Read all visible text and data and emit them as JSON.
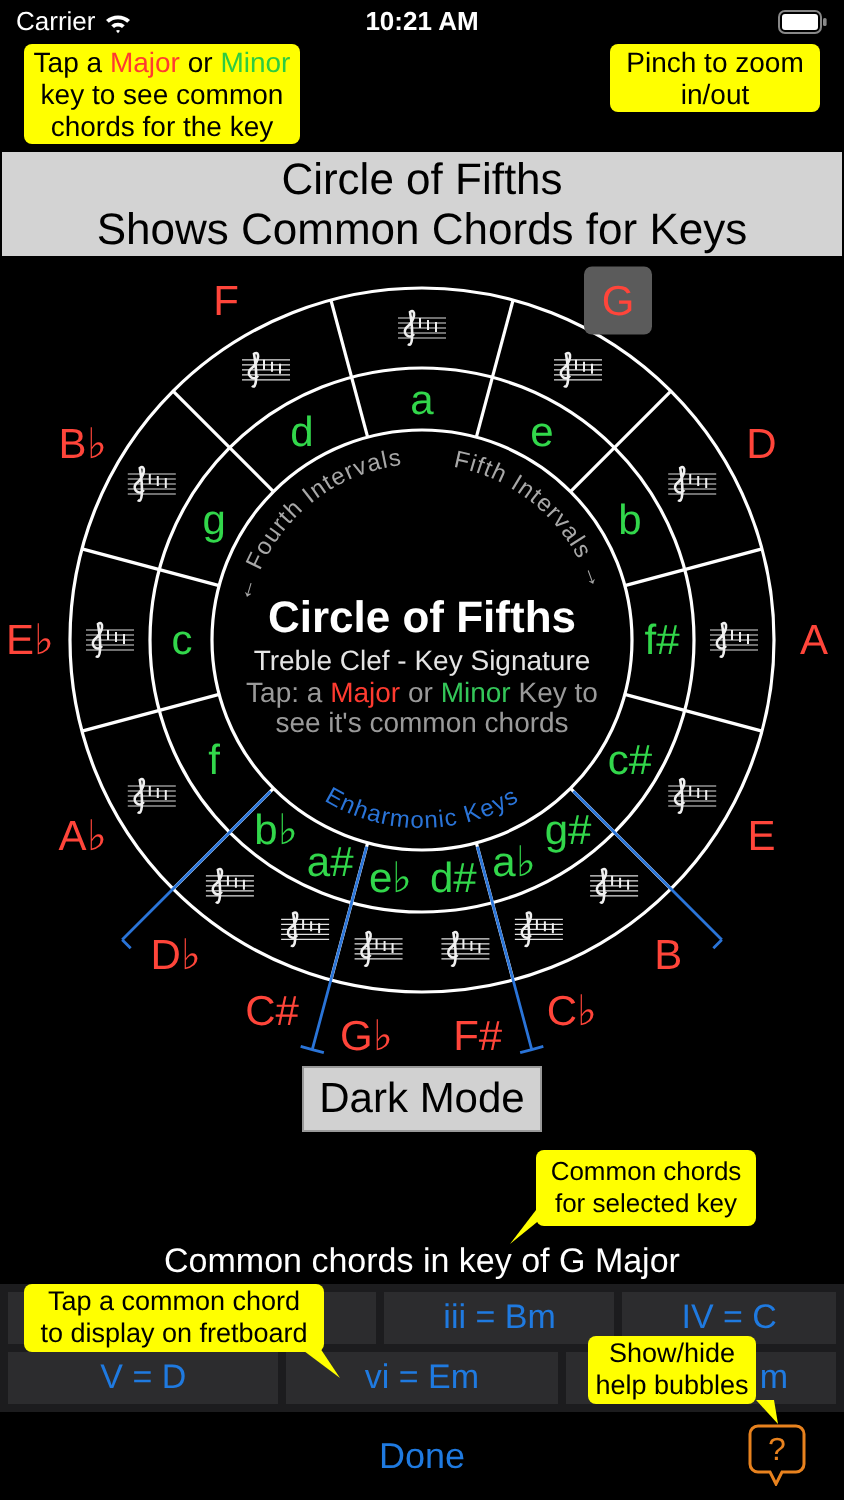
{
  "status_bar": {
    "carrier": "Carrier",
    "time": "10:21 AM"
  },
  "tip_keys": {
    "parts": [
      {
        "text": "Tap a ",
        "kind": "plain"
      },
      {
        "text": "Major",
        "kind": "major"
      },
      {
        "text": " or ",
        "kind": "plain"
      },
      {
        "text": "Minor",
        "kind": "minor"
      },
      {
        "text": " key to see common chords for the key",
        "kind": "plain"
      }
    ]
  },
  "tip_zoom": "Pinch to zoom in/out",
  "banner": [
    "Circle of Fifths",
    "Shows Common Chords for Keys"
  ],
  "circle": {
    "right_sectors": [
      {
        "minors": [
          "a"
        ]
      },
      {
        "majors": [
          {
            "label": "G",
            "selected": true
          }
        ],
        "minors": [
          "e"
        ]
      },
      {
        "majors": [
          {
            "label": "D",
            "selected": false
          }
        ],
        "minors": [
          "b"
        ]
      },
      {
        "majors": [
          {
            "label": "A",
            "selected": false
          }
        ],
        "minors": [
          "f#"
        ]
      },
      {
        "majors": [
          {
            "label": "E",
            "selected": false
          }
        ],
        "minors": [
          "c#"
        ]
      },
      {
        "majors": [
          {
            "label": "B",
            "selected": false
          },
          {
            "label": "C♭",
            "selected": false
          }
        ],
        "minors": [
          "g#",
          "a♭"
        ]
      }
    ],
    "left_sectors": [
      {
        "majors": [
          {
            "label": "F",
            "selected": false
          }
        ],
        "minors": [
          "d"
        ]
      },
      {
        "majors": [
          {
            "label": "B♭",
            "selected": false
          }
        ],
        "minors": [
          "g"
        ]
      },
      {
        "majors": [
          {
            "label": "E♭",
            "selected": false
          }
        ],
        "minors": [
          "c"
        ]
      },
      {
        "majors": [
          {
            "label": "A♭",
            "selected": false
          }
        ],
        "minors": [
          "f"
        ]
      },
      {
        "majors": [
          {
            "label": "D♭",
            "selected": false
          },
          {
            "label": "C#",
            "selected": false
          }
        ],
        "minors": [
          "b♭",
          "a#"
        ]
      }
    ],
    "bottom_sector": {
      "majors": [
        {
          "label": "G♭",
          "selected": false
        },
        {
          "label": "F#",
          "selected": false
        }
      ],
      "minors": [
        "e♭",
        "d#"
      ]
    },
    "fourth_label": "← Fourth Intervals",
    "fifth_label": "Fifth Intervals →",
    "enharmonic_label": "Enharmonic Keys",
    "title": "Circle of Fifths",
    "subtitle": "Treble Clef - Key Signature",
    "hint": {
      "parts": [
        {
          "text": "Tap: a ",
          "kind": "plain"
        },
        {
          "text": "Major",
          "kind": "major"
        },
        {
          "text": " or ",
          "kind": "plain"
        },
        {
          "text": "Minor",
          "kind": "minor"
        },
        {
          "text": " Key to see it's common chords",
          "kind": "plain"
        }
      ]
    }
  },
  "mode_button": "Dark Mode",
  "tip_chords": "Common chords for selected key",
  "chords_heading": "Common chords in key of G Major",
  "chord_rows": [
    [
      {
        "kind": "covered"
      },
      {
        "kind": "full",
        "label": "iii = Bm"
      },
      {
        "kind": "full",
        "label": "IV = C"
      }
    ],
    [
      {
        "kind": "full",
        "label": "V = D"
      },
      {
        "kind": "full",
        "label": "vi = Em"
      },
      {
        "kind": "covered",
        "label": "m"
      }
    ]
  ],
  "tip_tap": "Tap a common chord to display on fretboard",
  "tip_help": "Show/hide help bubbles",
  "done": "Done",
  "help_icon": "?"
}
